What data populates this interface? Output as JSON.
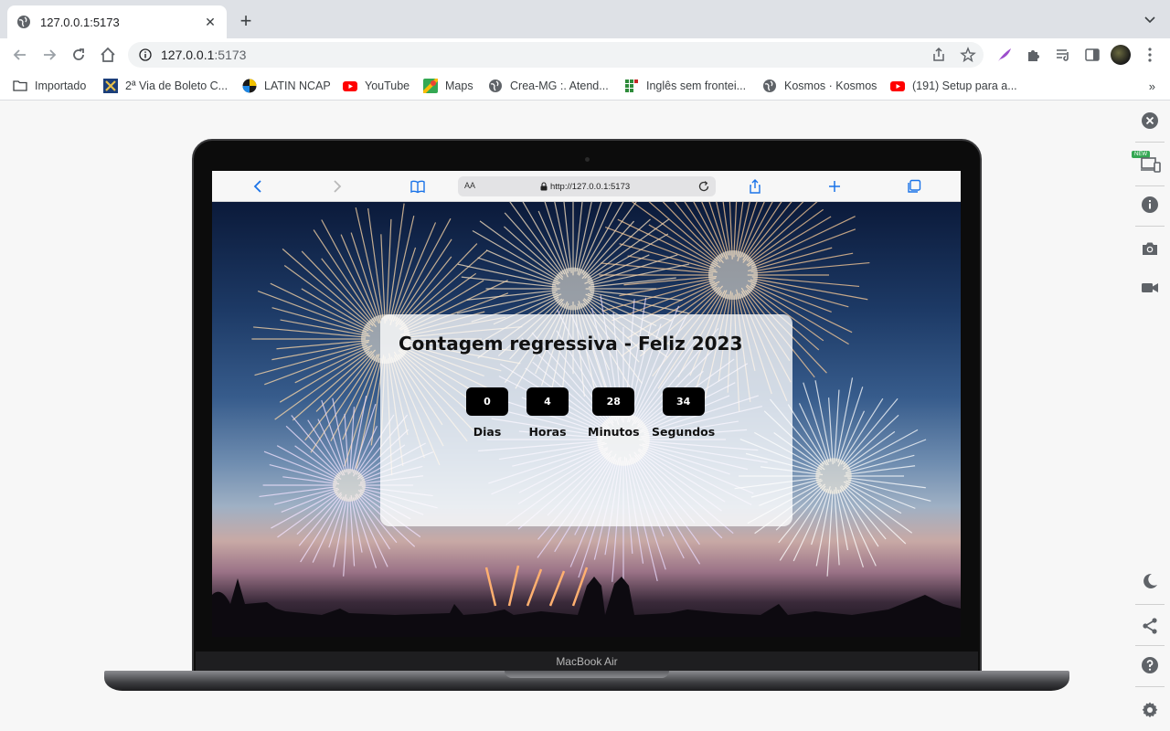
{
  "browser": {
    "tab": {
      "title": "127.0.0.1:5173",
      "favicon": "globe-icon"
    },
    "omnibox": {
      "host": "127.0.0.1",
      "port_path": ":5173"
    },
    "bookmarks": [
      {
        "label": "Importado",
        "icon": "folder-icon"
      },
      {
        "label": "2ª Via de Boleto C...",
        "icon": "boleto-icon"
      },
      {
        "label": "LATIN NCAP",
        "icon": "latin-ncap-icon"
      },
      {
        "label": "YouTube",
        "icon": "youtube-icon"
      },
      {
        "label": "Maps",
        "icon": "maps-icon"
      },
      {
        "label": "Crea-MG :. Atend...",
        "icon": "globe-icon"
      },
      {
        "label": "Inglês sem frontei...",
        "icon": "grid-icon"
      },
      {
        "label": "Kosmos · Kosmos",
        "icon": "globe-icon"
      },
      {
        "label": "(191) Setup para a...",
        "icon": "youtube-icon"
      }
    ],
    "bookmarks_more": "»",
    "sidebar": {
      "new_badge": "NEW"
    }
  },
  "device": {
    "label": "MacBook Air"
  },
  "safari": {
    "text_size": "AA",
    "url": "http://127.0.0.1:5173"
  },
  "countdown": {
    "title": "Contagem regressiva - Feliz 2023",
    "units": [
      {
        "value": "0",
        "label": "Dias"
      },
      {
        "value": "4",
        "label": "Horas"
      },
      {
        "value": "28",
        "label": "Minutos"
      },
      {
        "value": "34",
        "label": "Segundos"
      }
    ]
  },
  "colors": {
    "accent_blue": "#1a73e8",
    "youtube_red": "#ff0000",
    "new_badge_green": "#34a853"
  }
}
